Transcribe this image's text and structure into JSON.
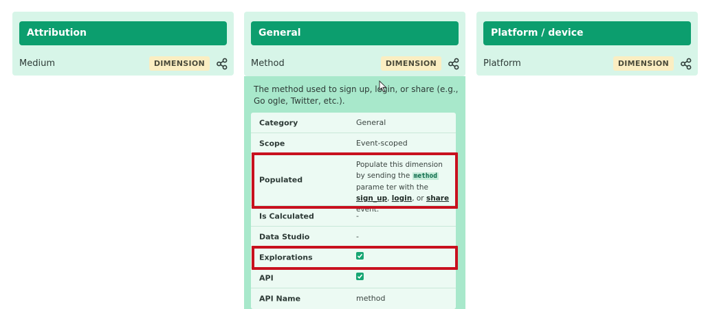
{
  "cards": [
    {
      "title": "Attribution",
      "row_label": "Medium",
      "badge": "DIMENSION"
    },
    {
      "title": "General",
      "row_label": "Method",
      "badge": "DIMENSION"
    },
    {
      "title": "Platform / device",
      "row_label": "Platform",
      "badge": "DIMENSION"
    }
  ],
  "detail": {
    "description": "The method used to sign up, login, or share (e.g., Go ogle, Twitter, etc.).",
    "rows": {
      "category": {
        "label": "Category",
        "value": "General"
      },
      "scope": {
        "label": "Scope",
        "value": "Event-scoped"
      },
      "populated": {
        "label": "Populated",
        "part1": "Populate this dimension by sending the ",
        "code": "method",
        "part2": " parame ter with the ",
        "link1": "sign_up",
        "sep1": ", ",
        "link2": "login",
        "sep2": ", or ",
        "link3": "share",
        "part3": " event."
      },
      "is_calculated": {
        "label": "Is Calculated",
        "value": "-"
      },
      "data_studio": {
        "label": "Data Studio",
        "value": "-"
      },
      "explorations": {
        "label": "Explorations",
        "checked": true
      },
      "api": {
        "label": "API",
        "checked": true
      },
      "api_name": {
        "label": "API Name",
        "value": "method"
      }
    }
  },
  "colors": {
    "header": "#0c9e6e",
    "card_bg": "#d7f5e8",
    "detail_bg": "#a8e8cb",
    "badge_bg": "#fbeec2",
    "highlight": "#c8101e"
  }
}
